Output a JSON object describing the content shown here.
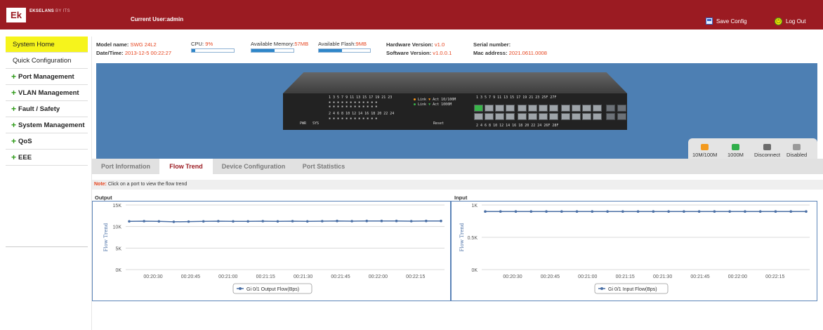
{
  "header": {
    "logo": "Ek",
    "brand": "EKSELANS",
    "brand_suffix": "BY ITS",
    "current_user": "Current User:admin",
    "save_config": "Save Config",
    "logout": "Log Out"
  },
  "sidebar": {
    "items": [
      {
        "label": "System Home",
        "active": true,
        "expandable": false
      },
      {
        "label": "Quick Configuration",
        "active": false,
        "expandable": false
      },
      {
        "label": "Port Management",
        "active": false,
        "expandable": true
      },
      {
        "label": "VLAN Management",
        "active": false,
        "expandable": true
      },
      {
        "label": "Fault / Safety",
        "active": false,
        "expandable": true
      },
      {
        "label": "System Management",
        "active": false,
        "expandable": true
      },
      {
        "label": "QoS",
        "active": false,
        "expandable": true
      },
      {
        "label": "EEE",
        "active": false,
        "expandable": true
      }
    ]
  },
  "info": {
    "model_label": "Model name:",
    "model_value": "SWG 24L2",
    "datetime_label": "Date/Time:",
    "datetime_value": "2013-12-5 00:22:27",
    "cpu_label": "CPU:",
    "cpu_value": "9%",
    "cpu_fraction": 0.09,
    "memory_label": "Available Memory:",
    "memory_value": "57MB",
    "memory_fraction": 0.55,
    "flash_label": "Available Flash:",
    "flash_value": "9MB",
    "flash_fraction": 0.45,
    "hw_label": "Hardware Version:",
    "hw_value": "v1.0",
    "sw_label": "Software Version:",
    "sw_value": "v1.0.0.1",
    "serial_label": "Serial number:",
    "serial_value": "",
    "mac_label": "Mac address:",
    "mac_value": "2021.0611.0008"
  },
  "device": {
    "led_row_top": "1  3  5  7  9 11 13 15 17 19 21 23",
    "led_row_bottom": "2  4  6  8 10 12 14 16 18 20 22 24",
    "pwr": "PWR",
    "sys": "SYS",
    "link1": "Link",
    "act1": "Act 10/100M",
    "link2": "Link",
    "act2": "Act 1000M",
    "reset": "Reset",
    "port_top_labels": "1    3    5    7    9    11   13   15   17   19   21   23   25F  27F",
    "port_bottom_labels": "2    4    6    8    10   12   14   16   18   20   22   24   26F  28F",
    "up_ports": [
      1
    ]
  },
  "legend": {
    "items": [
      {
        "label": "10M/100M",
        "color": "#f39a1e"
      },
      {
        "label": "1000M",
        "color": "#2fae4a"
      },
      {
        "label": "Disconnect",
        "color": "#6b6b6b"
      },
      {
        "label": "Disabled",
        "color": "#9a9a9a"
      }
    ]
  },
  "tabs": [
    {
      "label": "Port Information",
      "active": false
    },
    {
      "label": "Flow Trend",
      "active": true
    },
    {
      "label": "Device Configuration",
      "active": false
    },
    {
      "label": "Port Statistics",
      "active": false
    }
  ],
  "note": {
    "label": "Note:",
    "text": "Click on a port to view the flow trend"
  },
  "chart_data": [
    {
      "type": "line",
      "title": "Output",
      "ylabel": "Flow Trend",
      "ylim": [
        0,
        15000
      ],
      "yticks": [
        0,
        5000,
        10000,
        15000
      ],
      "ytick_labels": [
        "0K",
        "5K",
        "10K",
        "15K"
      ],
      "xtick_labels": [
        "00:20:30",
        "00:20:45",
        "00:21:00",
        "00:21:15",
        "00:21:30",
        "00:21:45",
        "00:22:00",
        "00:22:15"
      ],
      "grid": true,
      "legend_position": "bottom",
      "series": [
        {
          "name": "Gi 0/1 Output Flow(Bps)",
          "color": "#4a6fa5",
          "values": [
            11200,
            11250,
            11200,
            11100,
            11150,
            11200,
            11250,
            11200,
            11200,
            11250,
            11200,
            11250,
            11200,
            11250,
            11300,
            11250,
            11300,
            11300,
            11300,
            11250,
            11300,
            11300
          ]
        }
      ]
    },
    {
      "type": "line",
      "title": "Input",
      "ylabel": "Flow Trend",
      "ylim": [
        0,
        1
      ],
      "yticks": [
        0,
        0.5,
        1
      ],
      "ytick_labels": [
        "0K",
        "0.5K",
        "1K"
      ],
      "xtick_labels": [
        "00:20:30",
        "00:20:45",
        "00:21:00",
        "00:21:15",
        "00:21:30",
        "00:21:45",
        "00:22:00",
        "00:22:15"
      ],
      "grid": true,
      "legend_position": "bottom",
      "series": [
        {
          "name": "Gi 0/1 Input Flow(Bps)",
          "color": "#4a6fa5",
          "values": [
            0.9,
            0.9,
            0.9,
            0.9,
            0.9,
            0.9,
            0.9,
            0.9,
            0.9,
            0.9,
            0.9,
            0.9,
            0.9,
            0.9,
            0.9,
            0.9,
            0.9,
            0.9,
            0.9,
            0.9,
            0.9,
            0.9
          ]
        }
      ]
    }
  ]
}
